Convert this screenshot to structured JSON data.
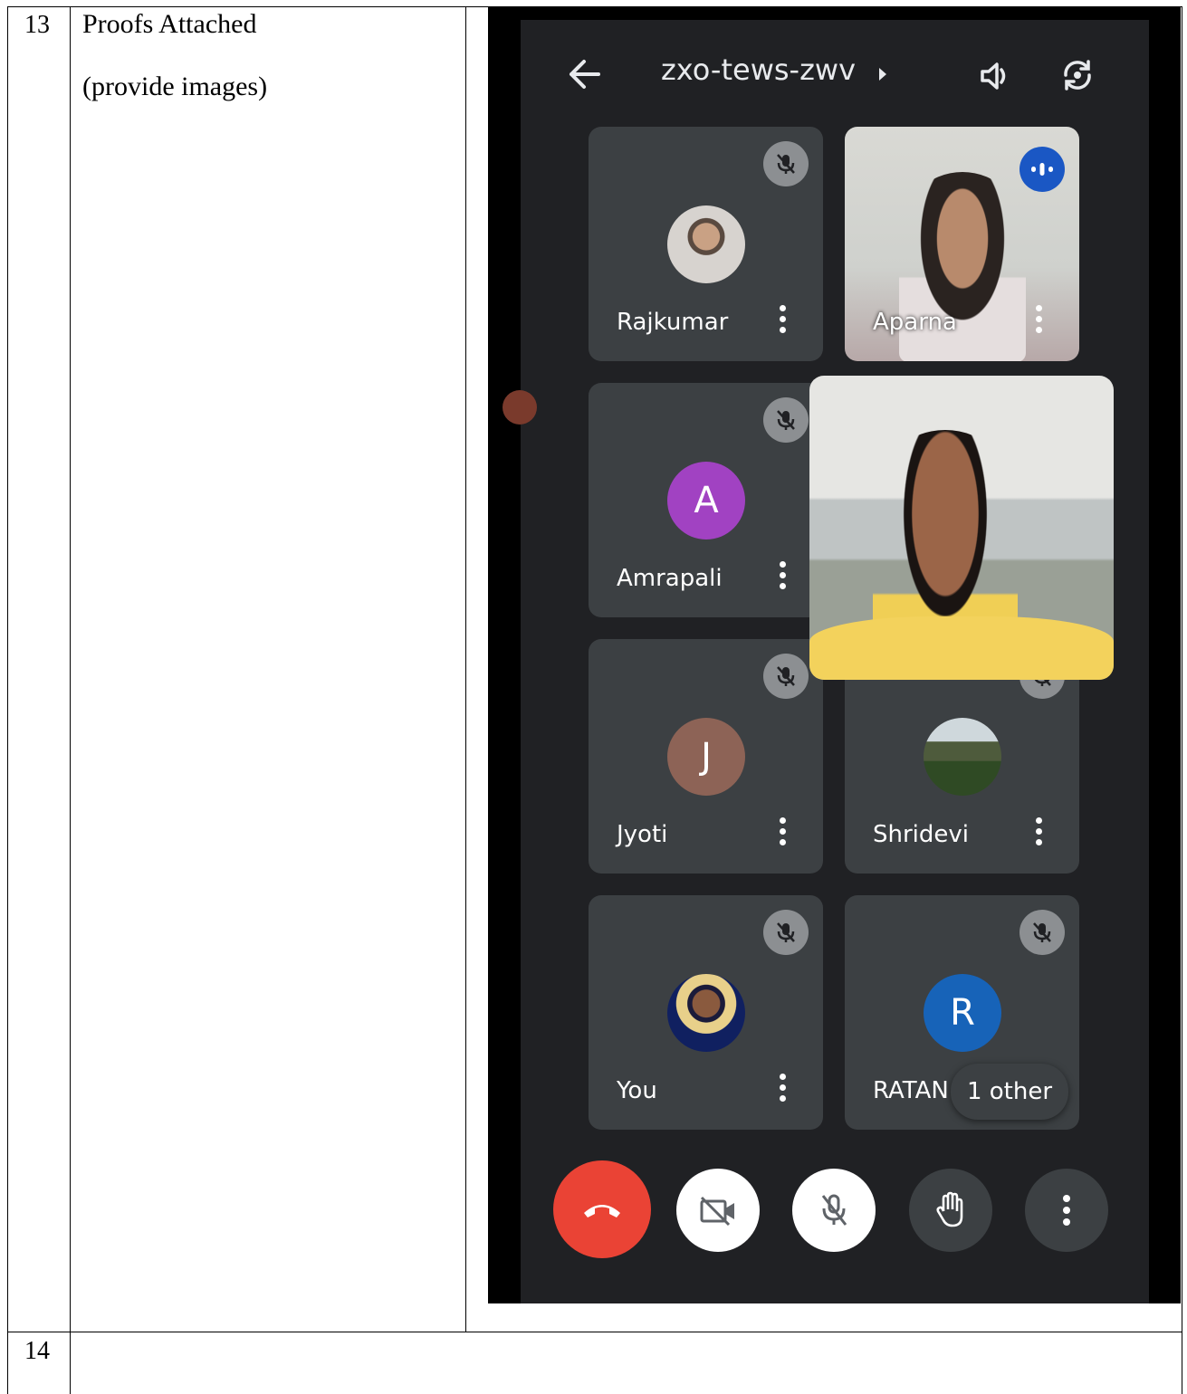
{
  "row13": {
    "number": "13",
    "title": "Proofs Attached",
    "subtitle": "(provide images)"
  },
  "row14": {
    "number": "14"
  },
  "meet": {
    "room_code": "zxo-tews-zwv",
    "participants": [
      {
        "name": "Rajkumar",
        "avatar": "photo",
        "muted": true
      },
      {
        "name": "Aparna",
        "avatar": "video",
        "speaking": true
      },
      {
        "name": "Amrapali",
        "avatar": "letter",
        "initial": "A",
        "color": "#a142c2",
        "muted": true
      },
      {
        "name": "Jyoti",
        "avatar": "letter",
        "initial": "J",
        "color": "#8d6356",
        "muted": true
      },
      {
        "name": "Shridevi",
        "avatar": "photo",
        "muted": true
      },
      {
        "name": "You",
        "avatar": "photo",
        "muted": true
      },
      {
        "name": "RATAN",
        "avatar": "letter",
        "initial": "R",
        "color": "#1763b8",
        "muted": true
      }
    ],
    "others_badge": "1 other",
    "colors": {
      "end_call": "#ea4335",
      "background": "#202124",
      "tile": "#3c4043",
      "speaking": "#1a57c4"
    }
  }
}
